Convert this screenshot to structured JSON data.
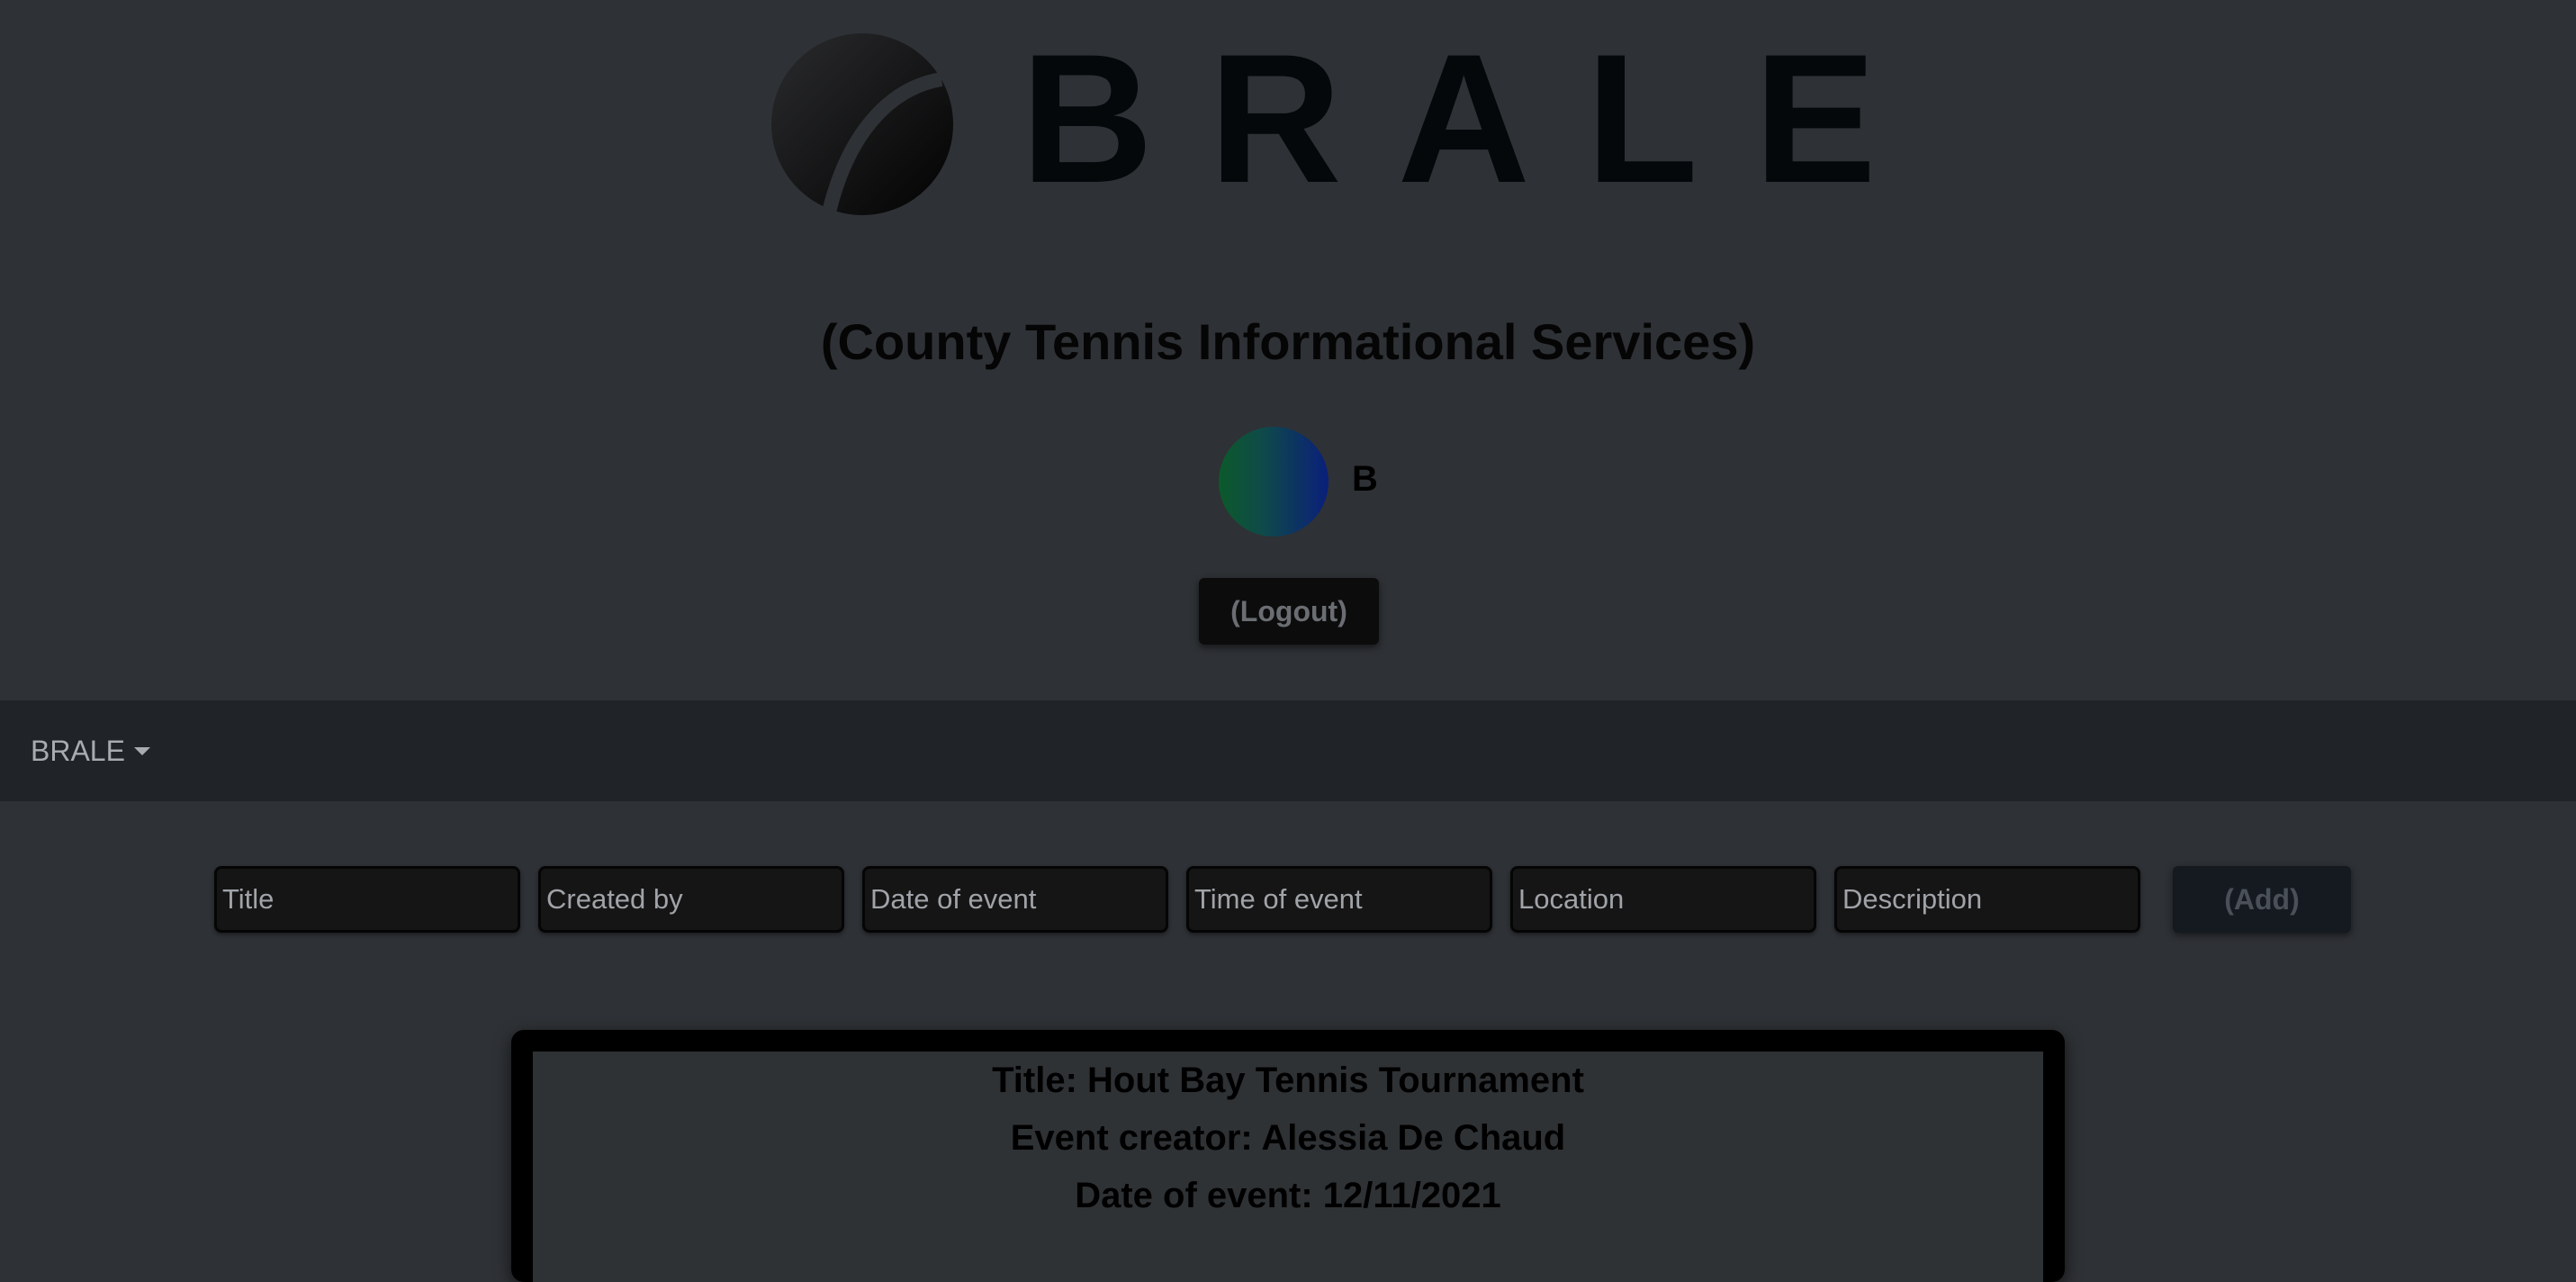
{
  "brand": {
    "logo_text": "BRALE",
    "subtitle": "(County Tennis Informational Services)"
  },
  "user": {
    "initial": "B",
    "logout_label": "(Logout)"
  },
  "navbar": {
    "brand_label": "BRALE"
  },
  "form": {
    "title_placeholder": "Title",
    "created_by_placeholder": "Created by",
    "date_placeholder": "Date of event",
    "time_placeholder": "Time of event",
    "location_placeholder": "Location",
    "description_placeholder": "Description",
    "add_label": "(Add)"
  },
  "event": {
    "title_line": "Title: Hout Bay Tennis Tournament",
    "creator_line": "Event creator: Alessia De Chaud",
    "date_line": "Date of event: 12/11/2021"
  },
  "colors": {
    "background": "#2e3135",
    "navbar": "#202327",
    "field": "#151515"
  }
}
